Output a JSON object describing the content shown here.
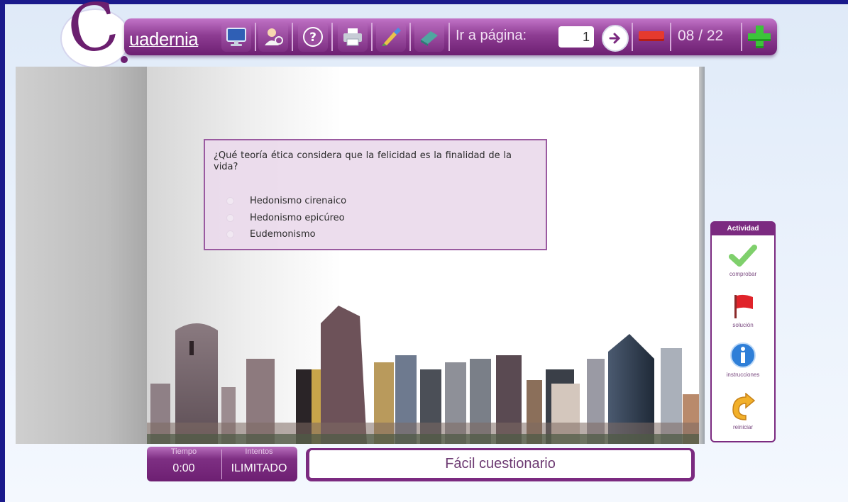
{
  "toolbar": {
    "brand": "uadernia",
    "buttons": [
      {
        "name": "monitor-icon"
      },
      {
        "name": "user-search-icon"
      },
      {
        "name": "help-icon"
      },
      {
        "name": "printer-icon"
      },
      {
        "name": "brush-icon"
      },
      {
        "name": "eraser-icon"
      }
    ],
    "goto_label": "Ir a página:",
    "page_input_value": "1",
    "page_count": "08 / 22"
  },
  "question": {
    "text": "¿Qué teoría ética considera que la felicidad es la finalidad de la vida?",
    "options": [
      "Hedonismo cirenaico",
      "Hedonismo epicúreo",
      "Eudemonismo"
    ]
  },
  "activity": {
    "title": "Actividad",
    "items": [
      {
        "label": "comprobar",
        "icon": "check-icon"
      },
      {
        "label": "solución",
        "icon": "flag-icon"
      },
      {
        "label": "instrucciones",
        "icon": "info-icon"
      },
      {
        "label": "reiniciar",
        "icon": "restart-icon"
      }
    ]
  },
  "status": {
    "time_label": "Tiempo",
    "time_value": "0:00",
    "attempts_label": "Intentos",
    "attempts_value": "ILIMITADO"
  },
  "activity_title": "Fácil cuestionario",
  "colors": {
    "frame": "#1a1a8c",
    "purple": "#7b2a80",
    "toolbar_light": "#c274c8"
  }
}
